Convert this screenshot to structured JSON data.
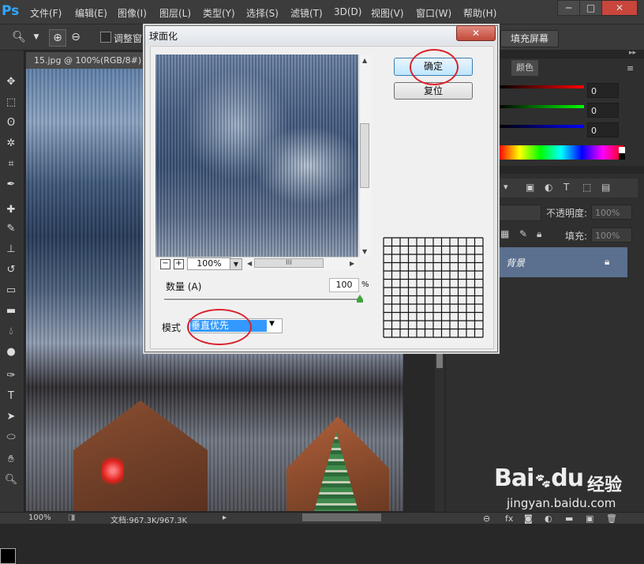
{
  "app": {
    "logo": "Ps"
  },
  "menu": [
    "文件(F)",
    "编辑(E)",
    "图像(I)",
    "图层(L)",
    "类型(Y)",
    "选择(S)",
    "滤镜(T)",
    "3D(D)",
    "视图(V)",
    "窗口(W)",
    "帮助(H)"
  ],
  "window_controls": {
    "minimize": "─",
    "maximize": "□",
    "close": "✕"
  },
  "options_bar": {
    "resize_windows_label": "调整窗",
    "fill_screen_button": "填充屏幕"
  },
  "document": {
    "tab_label": "15.jpg @ 100%(RGB/8#)"
  },
  "dialog": {
    "title": "球面化",
    "close": "✕",
    "ok_button": "确定",
    "reset_button": "复位",
    "zoom_value": "100%",
    "zoom_minus": "−",
    "zoom_plus": "+",
    "amount_label": "数量 (A)",
    "amount_value": "100",
    "amount_unit": "%",
    "amount_percent": 100,
    "mode_label": "模式",
    "mode_value": "垂直优先",
    "hscroll_grip": "III"
  },
  "panels": {
    "color_tab": "颜色",
    "rgb_values": [
      "0",
      "0",
      "0"
    ],
    "slider_colors": [
      "#cc1f1f",
      "#22b322",
      "#2244dd"
    ],
    "opacity_label": "不透明度:",
    "opacity_value": "100%",
    "fill_label": "填充:",
    "fill_value": "100%",
    "layer_name": "背景"
  },
  "status": {
    "zoom": "100%",
    "doc_info": "文档:967.3K/967.3K"
  },
  "watermark": {
    "brand": "Bai",
    "brand2": "du",
    "jingyan": "经验",
    "url": "jingyan.baidu.com"
  },
  "colors": {
    "accent_blue": "#31a8ff",
    "selection_blue": "#3399ff",
    "highlight_red": "#d9232d"
  }
}
